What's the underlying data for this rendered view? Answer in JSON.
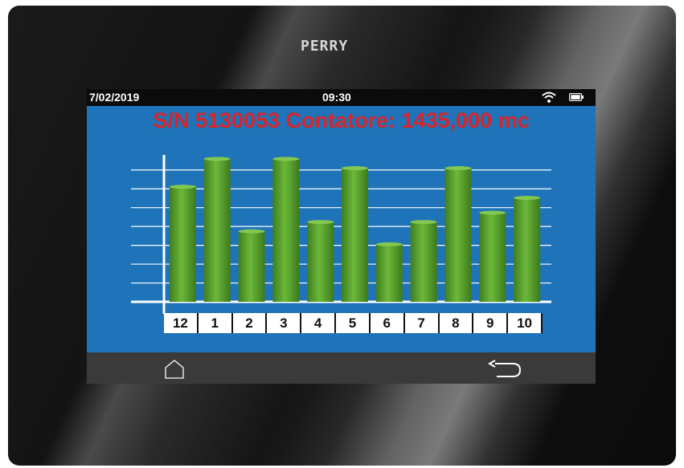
{
  "device": {
    "brand": "PERRY"
  },
  "status": {
    "date": "7/02/2019",
    "time": "09:30"
  },
  "header": {
    "title": "S/N 5130053 Contatore: 1435,000 mc"
  },
  "colors": {
    "screen_bg": "#1f73b8",
    "title": "#d7262b",
    "bar": "#5aa02c",
    "nav": "#3a3a3a"
  },
  "icons": {
    "wifi": "wifi-icon",
    "battery": "battery-icon",
    "home": "home-icon",
    "back": "back-icon"
  },
  "chart_data": {
    "type": "bar",
    "categories": [
      "12",
      "1",
      "2",
      "3",
      "4",
      "5",
      "6",
      "7",
      "8",
      "9",
      "10"
    ],
    "values": [
      6.2,
      7.7,
      3.8,
      7.7,
      4.3,
      7.2,
      3.1,
      4.3,
      7.2,
      4.8,
      5.6
    ],
    "ylim": [
      0,
      8
    ],
    "grid": true,
    "title": "",
    "xlabel": "",
    "ylabel": ""
  }
}
